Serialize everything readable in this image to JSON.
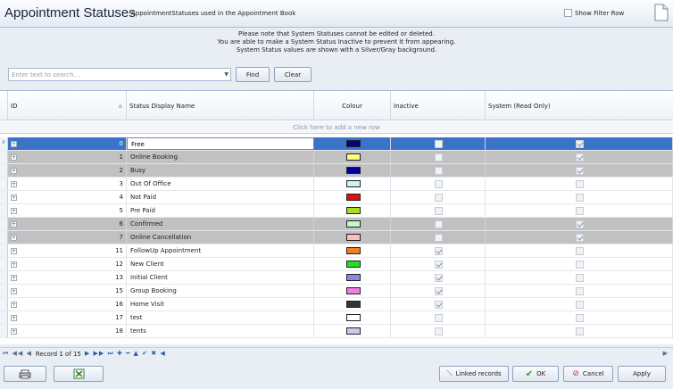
{
  "header": {
    "title": "Appointment Statuses",
    "subtitle": "AppointmentStatuses used in the Appointment Book",
    "show_filter_row_label": "Show Filter Row"
  },
  "notice": {
    "line1": "Please note that System Statuses cannot be edited or deleted.",
    "line2": "You are able to make a System Status Inactive to prevent it from appearing.",
    "line3": "System Status values are shown with a Silver/Gray background."
  },
  "search": {
    "placeholder": "Enter text to search...",
    "find_label": "Find",
    "clear_label": "Clear"
  },
  "grid": {
    "columns": [
      "ID",
      "Status Display Name",
      "Colour",
      "Inactive",
      "System (Read Only)"
    ],
    "add_row_text": "Click here to add a new row",
    "rows": [
      {
        "id": "0",
        "name": "Free",
        "color": "#00008b",
        "inactive": false,
        "system": true,
        "selected": true
      },
      {
        "id": "1",
        "name": "Online Booking",
        "color": "#ffff80",
        "inactive": false,
        "system": true
      },
      {
        "id": "2",
        "name": "Busy",
        "color": "#0000a8",
        "inactive": false,
        "system": true
      },
      {
        "id": "3",
        "name": "Out Of Office",
        "color": "#c8f4f4",
        "inactive": false,
        "system": false
      },
      {
        "id": "4",
        "name": "Not Paid",
        "color": "#e01010",
        "inactive": false,
        "system": false
      },
      {
        "id": "5",
        "name": "Pre Paid",
        "color": "#a8e020",
        "inactive": false,
        "system": false
      },
      {
        "id": "6",
        "name": "Confirmed",
        "color": "#c8f8c8",
        "inactive": false,
        "system": true
      },
      {
        "id": "7",
        "name": "Online Cancellation",
        "color": "#f8c0c0",
        "inactive": false,
        "system": true
      },
      {
        "id": "11",
        "name": "FollowUp Appointment",
        "color": "#f08020",
        "inactive": true,
        "system": false
      },
      {
        "id": "12",
        "name": "New Client",
        "color": "#20e020",
        "inactive": true,
        "system": false
      },
      {
        "id": "13",
        "name": "Initial Client",
        "color": "#8888e0",
        "inactive": true,
        "system": false
      },
      {
        "id": "15",
        "name": "Group Booking",
        "color": "#f080e0",
        "inactive": true,
        "system": false
      },
      {
        "id": "16",
        "name": "Home Visit",
        "color": "#303830",
        "inactive": true,
        "system": false
      },
      {
        "id": "17",
        "name": "test",
        "color": "#ffffff",
        "inactive": false,
        "system": false
      },
      {
        "id": "18",
        "name": "tents",
        "color": "#c8c8f0",
        "inactive": false,
        "system": false
      }
    ]
  },
  "navigator": {
    "record_text": "Record 1 of 15"
  },
  "footer": {
    "linked_records_label": "Linked records",
    "ok_label": "OK",
    "cancel_label": "Cancel",
    "apply_label": "Apply"
  },
  "colors": {
    "selection": "#3a73c7",
    "system_row": "#c1c1c1"
  }
}
